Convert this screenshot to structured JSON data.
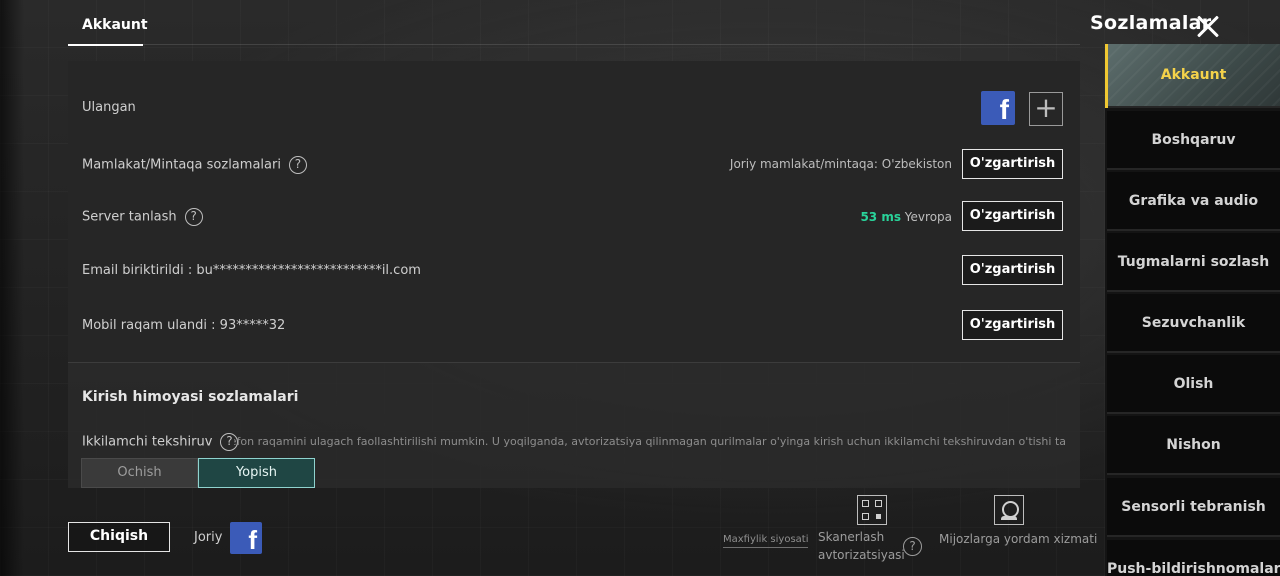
{
  "header": {
    "page_title": "Akkaunt",
    "settings_title": "Sozlamalar"
  },
  "account": {
    "linked_label": "Ulangan",
    "region": {
      "label": "Mamlakat/Mintaqa sozlamalari",
      "current": "Joriy mamlakat/mintaqa: O'zbekiston",
      "button": "O'zgartirish"
    },
    "server": {
      "label": "Server tanlash",
      "ping": "53 ms",
      "name": "Yevropa",
      "button": "O'zgartirish"
    },
    "email": {
      "label": "Email biriktirildi : bu**************************il.com",
      "button": "O'zgartirish"
    },
    "phone": {
      "label": "Mobil raqam ulandi : 93*****32",
      "button": "O'zgartirish"
    }
  },
  "login_protection": {
    "title": "Kirish himoyasi sozlamalari",
    "verify_label": "Ikkilamchi tekshiruv",
    "verify_desc": "elefon raqamini ulagach faollashtirilishi mumkin. U yoqilganda, avtorizatsiya qilinmagan qurilmalar o'yinga kirish uchun ikkilamchi tekshiruvdan o'tishi ta",
    "toggle": {
      "off": "Ochish",
      "on": "Yopish",
      "selected": "Yopish"
    }
  },
  "footer": {
    "logout": "Chiqish",
    "current": "Joriy",
    "privacy": "Maxfiylik siyosati",
    "scan_line1": "Skanerlash",
    "scan_line2": "avtorizatsiyasi",
    "support": "Mijozlarga yordam xizmati"
  },
  "nav": {
    "items": [
      "Akkaunt",
      "Boshqaruv",
      "Grafika va audio",
      "Tugmalarni sozlash",
      "Sezuvchanlik",
      "Olish",
      "Nishon",
      "Sensorli tebranish",
      "Push-bildirishnomalar"
    ],
    "active": "Akkaunt"
  },
  "colors": {
    "accent_gold": "#f4d24a",
    "ping_green": "#29d39a",
    "facebook_blue": "#3b5bb8",
    "toggle_on": "#1f4644"
  },
  "icons": [
    "close-icon",
    "facebook-icon",
    "plus-icon",
    "help-icon",
    "qr-scan-icon",
    "support-icon"
  ]
}
